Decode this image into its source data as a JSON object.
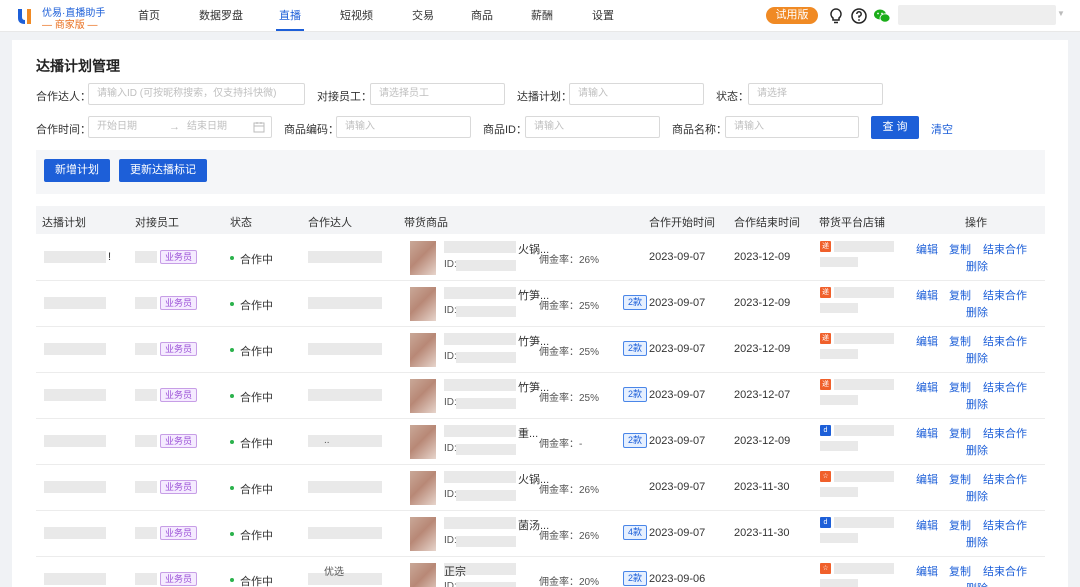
{
  "app": {
    "logo_name": "优易·直播助手",
    "logo_sub": "— 商家版 —"
  },
  "nav": {
    "items": [
      {
        "label": "首页"
      },
      {
        "label": "数据罗盘"
      },
      {
        "label": "直播"
      },
      {
        "label": "短视频"
      },
      {
        "label": "交易"
      },
      {
        "label": "商品"
      },
      {
        "label": "薪酬"
      },
      {
        "label": "设置"
      }
    ],
    "active": "直播",
    "trial_badge": "试用版",
    "icons": [
      "bulb-icon",
      "help-icon",
      "wechat-icon"
    ]
  },
  "page": {
    "title": "达播计划管理"
  },
  "filters": {
    "partner_label": "合作达人：",
    "partner_placeholder": "请输入ID (可按昵称搜索，仅支持抖快微)",
    "staff_label": "对接员工：",
    "staff_placeholder": "请选择员工",
    "plan_label": "达播计划：",
    "plan_placeholder": "请输入",
    "status_label": "状态：",
    "status_placeholder": "请选择",
    "time_label": "合作时间：",
    "start_placeholder": "开始日期",
    "end_placeholder": "结束日期",
    "date_sep": "→",
    "code_label": "商品编码：",
    "code_placeholder": "请输入",
    "pid_label": "商品ID：",
    "pid_placeholder": "请输入",
    "pname_label": "商品名称：",
    "pname_placeholder": "请输入",
    "query_button": "查 询",
    "clear_link": "清空"
  },
  "toolbar": {
    "add_button": "新增计划",
    "update_button": "更新达播标记"
  },
  "table": {
    "headers": [
      "达播计划",
      "对接员工",
      "状态",
      "合作达人",
      "带货商品",
      "合作开始时间",
      "合作结束时间",
      "带货平台店铺",
      "操作"
    ],
    "actions": {
      "edit": "编辑",
      "copy": "复制",
      "end": "结束合作",
      "delete": "删除"
    },
    "rows": [
      {
        "staff_tag": "业务员",
        "status": "合作中",
        "partner_text": "",
        "product_title": "火锅...",
        "product_id": "ID:",
        "commission": "佣金率：26%",
        "count": "",
        "start": "2023-09-07",
        "end": "2023-12-09",
        "shop_icon": "递",
        "shop_color": "#f0602b",
        "plan_suffix": "!"
      },
      {
        "staff_tag": "业务员",
        "status": "合作中",
        "partner_text": "",
        "product_title": "竹笋...",
        "product_id": "ID:",
        "commission": "佣金率：25%",
        "count": "2款",
        "start": "2023-09-07",
        "end": "2023-12-09",
        "shop_icon": "递",
        "shop_color": "#f0602b",
        "plan_suffix": ""
      },
      {
        "staff_tag": "业务员",
        "status": "合作中",
        "partner_text": "",
        "product_title": "竹笋...",
        "product_id": "ID:",
        "commission": "佣金率：25%",
        "count": "2款",
        "start": "2023-09-07",
        "end": "2023-12-09",
        "shop_icon": "递",
        "shop_color": "#f0602b",
        "plan_suffix": ""
      },
      {
        "staff_tag": "业务员",
        "status": "合作中",
        "partner_text": "",
        "product_title": "竹笋...",
        "product_id": "ID:",
        "commission": "佣金率：25%",
        "count": "2款",
        "start": "2023-09-07",
        "end": "2023-12-07",
        "shop_icon": "递",
        "shop_color": "#f0602b",
        "plan_suffix": ""
      },
      {
        "staff_tag": "业务员",
        "status": "合作中",
        "partner_text": "..",
        "product_title": "重...",
        "product_id": "ID:",
        "commission": "佣金率：-",
        "count": "2款",
        "start": "2023-09-07",
        "end": "2023-12-09",
        "shop_icon": "d",
        "shop_color": "#1d5fd8",
        "plan_suffix": ""
      },
      {
        "staff_tag": "业务员",
        "status": "合作中",
        "partner_text": "",
        "product_title": "火锅...",
        "product_id": "ID:",
        "commission": "佣金率：26%",
        "count": "",
        "start": "2023-09-07",
        "end": "2023-11-30",
        "shop_icon": "☆",
        "shop_color": "#f0602b",
        "plan_suffix": ""
      },
      {
        "staff_tag": "业务员",
        "status": "合作中",
        "partner_text": "",
        "product_title": "菌汤...",
        "product_id": "ID:",
        "commission": "佣金率：26%",
        "count": "4款",
        "start": "2023-09-07",
        "end": "2023-11-30",
        "shop_icon": "d",
        "shop_color": "#1d5fd8",
        "plan_suffix": ""
      },
      {
        "staff_tag": "业务员",
        "status": "合作中",
        "partner_text": "优选",
        "product_title": "正宗",
        "product_id": "ID:",
        "commission": "佣金率：20%",
        "count": "2款",
        "start": "2023-09-06",
        "end": "",
        "shop_icon": "☆",
        "shop_color": "#f0602b",
        "plan_suffix": ""
      }
    ]
  },
  "colors": {
    "accent": "#1d5fd8",
    "trial": "#f08a24",
    "status_green": "#2bb24c",
    "tag_purple": "#9a4fd6"
  }
}
